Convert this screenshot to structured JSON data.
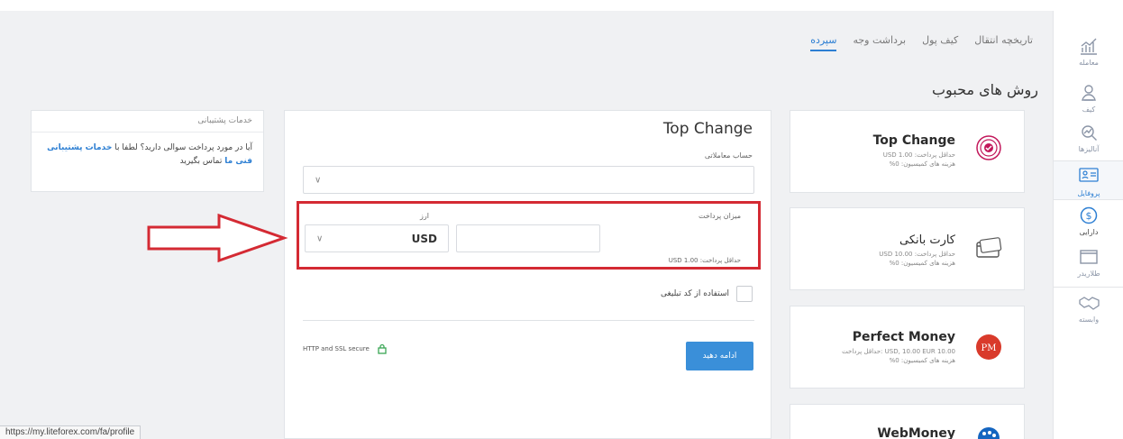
{
  "sidebar": {
    "items": [
      {
        "label": "معامله",
        "icon": "chart-icon"
      },
      {
        "label": "کیف",
        "icon": "user-icon"
      },
      {
        "label": "آنالیزها",
        "icon": "analytics-icon"
      },
      {
        "label": "پروفایل",
        "icon": "profile-card-icon"
      },
      {
        "label": "دارایی",
        "icon": "dollar-icon"
      },
      {
        "label": "طلاریدر",
        "icon": "window-icon"
      },
      {
        "label": "وابسته",
        "icon": "handshake-icon"
      }
    ]
  },
  "tabs": [
    "سپرده",
    "برداشت وجه",
    "کیف پول",
    "تاریخچه انتقال"
  ],
  "methods_title": "روش های محبوب",
  "methods": [
    {
      "name": "Top Change",
      "line1": "حداقل پرداخت: 1.00 USD",
      "line2": "هزینه های کمیسیون: 0%"
    },
    {
      "name": "کارت بانکی",
      "line1": "حداقل پرداخت: 10.00 USD",
      "line2": "هزینه های کمیسیون: 0%"
    },
    {
      "name": "Perfect Money",
      "line1": "10.00 USD, 10.00 EUR :حداقل پرداخت",
      "line2": "هزینه های کمیسیون: 0%"
    },
    {
      "name": "WebMoney"
    }
  ],
  "pm_logo_text": "PM",
  "form": {
    "title": "Top Change",
    "account_label": "حساب معاملاتی",
    "amount_label": "میزان پرداخت",
    "currency_label": "ارز",
    "currency_value": "USD",
    "min_payment": "حداقل پرداخت: USD 1.00",
    "promo_label": "استفاده از کد تبلیغی",
    "secure_text": "HTTP and SSL secure",
    "continue_label": "ادامه دهید"
  },
  "support": {
    "title": "خدمات پشتیبانی",
    "text": "آیا در مورد پرداخت سوالی دارید؟ لطفا با",
    "link": "خدمات پشتیبانی فنی ما",
    "tail": "تماس بگیرید"
  },
  "statusbar": "https://my.liteforex.com/fa/profile",
  "colors": {
    "accent": "#2d7fd3",
    "highlight": "#d42a33",
    "button": "#3a8fd9"
  }
}
